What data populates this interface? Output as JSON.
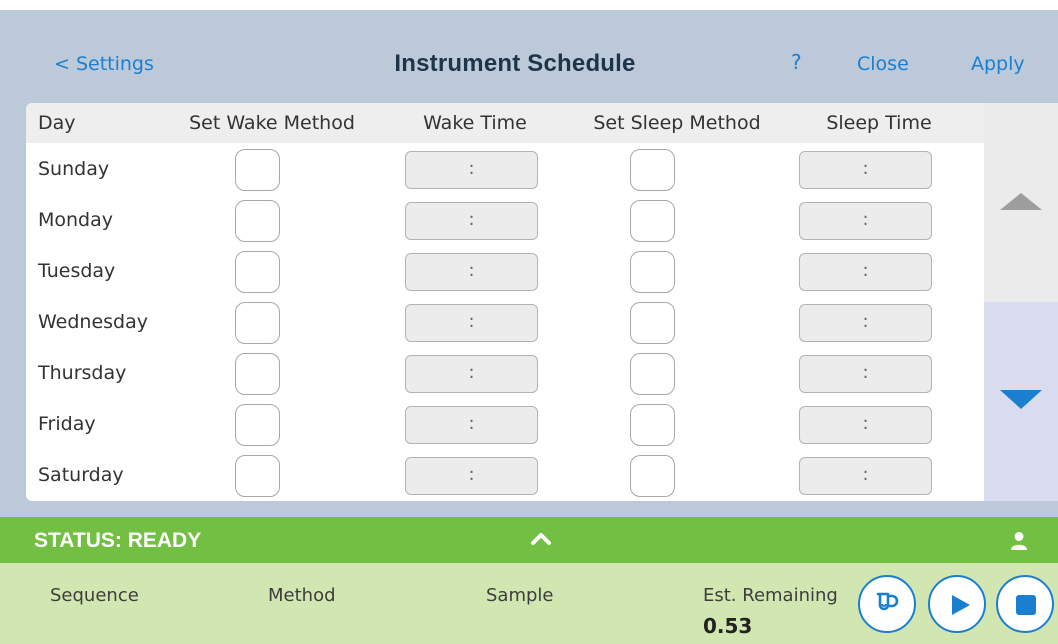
{
  "header": {
    "back_label": "< Settings",
    "title": "Instrument Schedule",
    "help_label": "?",
    "close_label": "Close",
    "apply_label": "Apply"
  },
  "table": {
    "columns": [
      "Day",
      "Set Wake Method",
      "Wake Time",
      "Set Sleep Method",
      "Sleep Time"
    ],
    "rows": [
      {
        "day": "Sunday",
        "wake_time": ":",
        "sleep_time": ":"
      },
      {
        "day": "Monday",
        "wake_time": ":",
        "sleep_time": ":"
      },
      {
        "day": "Tuesday",
        "wake_time": ":",
        "sleep_time": ":"
      },
      {
        "day": "Wednesday",
        "wake_time": ":",
        "sleep_time": ":"
      },
      {
        "day": "Thursday",
        "wake_time": ":",
        "sleep_time": ":"
      },
      {
        "day": "Friday",
        "wake_time": ":",
        "sleep_time": ":"
      },
      {
        "day": "Saturday",
        "wake_time": ":",
        "sleep_time": ":"
      }
    ]
  },
  "status": {
    "text": "STATUS: READY"
  },
  "info": {
    "sequence_label": "Sequence",
    "method_label": "Method",
    "sample_label": "Sample",
    "est_remaining_label": "Est. Remaining",
    "est_remaining_value": "0.53"
  },
  "icons": {
    "collapse": "chevron-up-icon",
    "user": "user-icon",
    "vial": "vial-icon",
    "play": "play-icon",
    "stop": "stop-icon",
    "scroll_up": "triangle-up-icon",
    "scroll_down": "triangle-down-icon"
  },
  "colors": {
    "accent": "#1a7fd0",
    "status_green": "#72bf44",
    "info_green": "#d2e6b1",
    "header_bg": "#bcc9d8"
  }
}
